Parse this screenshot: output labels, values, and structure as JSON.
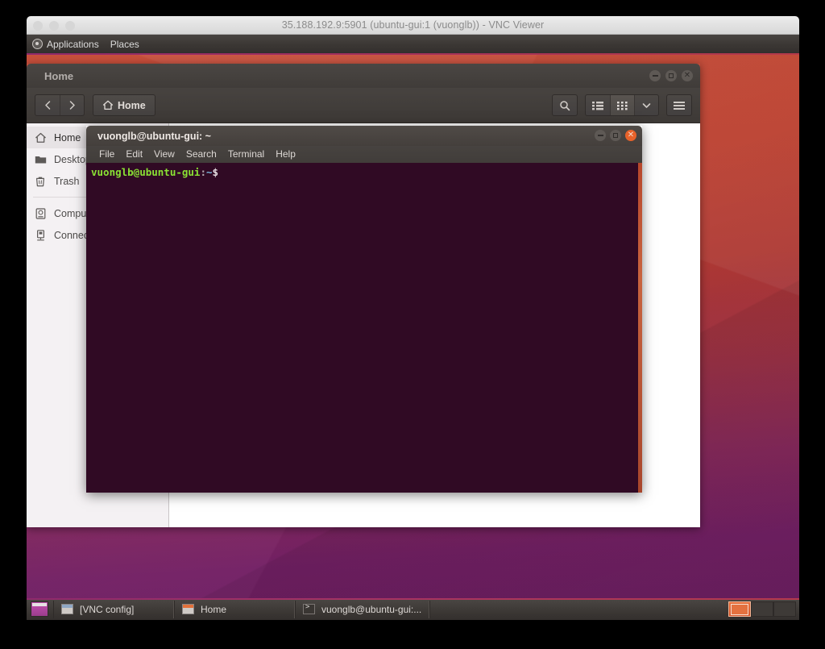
{
  "vnc": {
    "title": "35.188.192.9:5901 (ubuntu-gui:1 (vuonglb)) - VNC Viewer",
    "traffic_lights": [
      "close",
      "minimize",
      "maximize"
    ]
  },
  "top_panel": {
    "applications_label": "Applications",
    "places_label": "Places",
    "logo_icon": "ubuntu-logo-icon"
  },
  "files_window": {
    "title": "Home",
    "path_button_label": "Home",
    "path_button_icon": "home-icon",
    "nav_back_icon": "chevron-left-icon",
    "nav_forward_icon": "chevron-right-icon",
    "toolbar_right": [
      {
        "name": "search-icon",
        "label": "search"
      },
      {
        "name": "list-view-icon",
        "label": "list view"
      },
      {
        "name": "grid-view-icon",
        "label": "grid view"
      },
      {
        "name": "chevron-down-icon",
        "label": "view options"
      },
      {
        "name": "hamburger-menu-icon",
        "label": "menu"
      }
    ],
    "window_controls": [
      "minimize",
      "maximize",
      "close"
    ],
    "sidebar": {
      "items": [
        {
          "label": "Home",
          "icon": "home-icon",
          "selected": true
        },
        {
          "label": "Desktop",
          "icon": "folder-icon",
          "selected": false
        },
        {
          "label": "Trash",
          "icon": "trash-icon",
          "selected": false
        },
        {
          "label": "Computer",
          "icon": "computer-icon",
          "selected": false
        },
        {
          "label": "Connect to Server",
          "icon": "network-server-icon",
          "selected": false
        }
      ]
    }
  },
  "terminal": {
    "title": "vuonglb@ubuntu-gui: ~",
    "menus": [
      "File",
      "Edit",
      "View",
      "Search",
      "Terminal",
      "Help"
    ],
    "window_controls": [
      "minimize",
      "maximize",
      "close"
    ],
    "prompt": {
      "user_host": "vuonglb@ubuntu-gui",
      "separator": ":",
      "path": "~",
      "sigil": "$"
    },
    "colors": {
      "background": "#300a24",
      "user_host": "#8ae234",
      "path": "#7ab8dd",
      "text": "#e6dfe3"
    }
  },
  "taskbar": {
    "show_desktop_icon": "show-desktop-icon",
    "tasks": [
      {
        "label": "[VNC config]",
        "icon": "window-icon",
        "active": false
      },
      {
        "label": "Home",
        "icon": "files-icon",
        "active": false
      },
      {
        "label": "vuonglb@ubuntu-gui:...",
        "icon": "terminal-icon",
        "active": false
      }
    ],
    "workspaces": [
      {
        "active": true
      },
      {
        "active": false
      },
      {
        "active": false
      }
    ]
  },
  "theme": {
    "ubuntu_orange": "#e8703c",
    "panel_dark": "#3b3734",
    "terminal_bg": "#300a24",
    "wallpaper_top": "#c5452f",
    "wallpaper_bottom": "#6e1f63"
  }
}
